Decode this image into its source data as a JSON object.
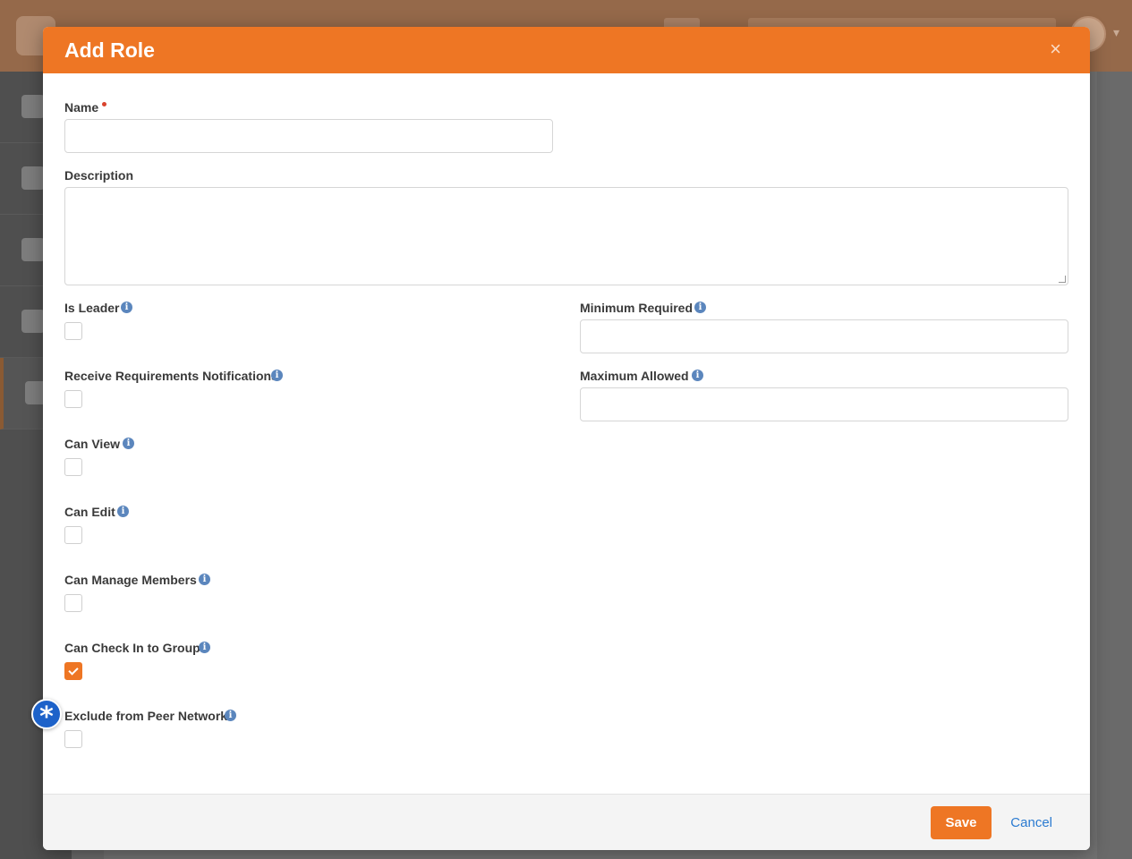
{
  "modal": {
    "title": "Add Role",
    "close_label": "×"
  },
  "form": {
    "name_label": "Name",
    "name_value": "",
    "description_label": "Description",
    "description_value": "",
    "is_leader_label": "Is Leader",
    "is_leader_checked": false,
    "receive_notifications_label": "Receive Requirements Notifications",
    "receive_notifications_checked": false,
    "can_view_label": "Can View",
    "can_view_checked": false,
    "can_edit_label": "Can Edit",
    "can_edit_checked": false,
    "can_manage_members_label": "Can Manage Members",
    "can_manage_members_checked": false,
    "can_check_in_label": "Can Check In to Group",
    "can_check_in_checked": true,
    "exclude_peer_label": "Exclude from Peer Network",
    "exclude_peer_checked": false,
    "minimum_required_label": "Minimum Required",
    "minimum_required_value": "",
    "maximum_allowed_label": "Maximum Allowed",
    "maximum_allowed_value": ""
  },
  "footer": {
    "save_label": "Save",
    "cancel_label": "Cancel"
  },
  "icons": {
    "info": "info-icon",
    "close": "close-icon",
    "new_feature": "asterisk-icon"
  },
  "colors": {
    "accent": "#ee7624",
    "link": "#2b7bd1",
    "info": "#5b86bd",
    "required": "#d9432d",
    "badge": "#1d62c9"
  }
}
